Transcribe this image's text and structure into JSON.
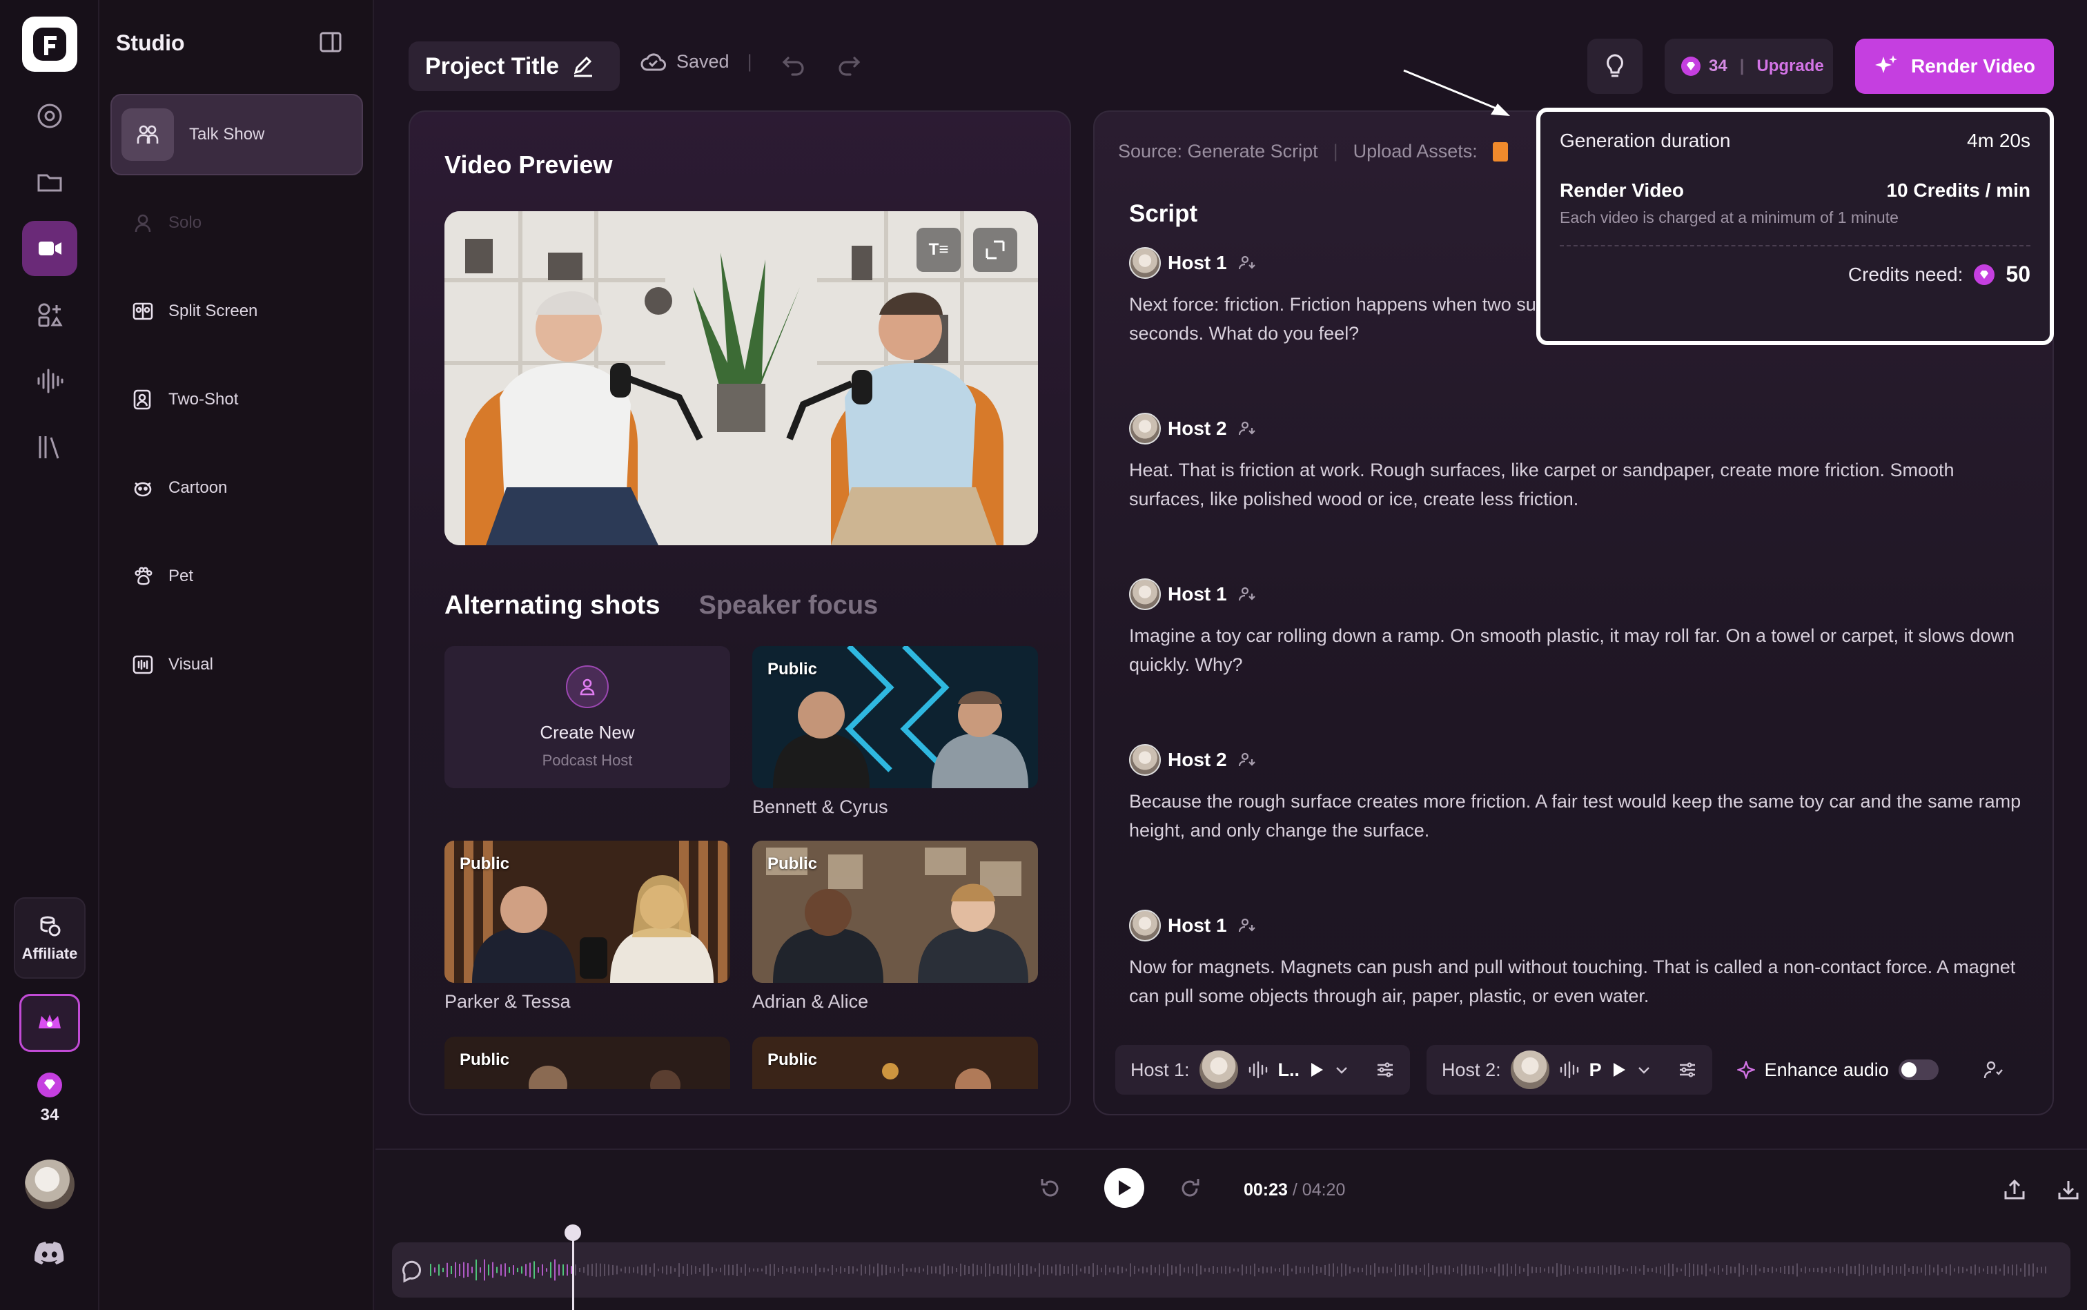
{
  "rail": {
    "affiliate_label": "Affiliate",
    "credits": "34"
  },
  "studio": {
    "title": "Studio",
    "items": [
      {
        "label": "Talk Show",
        "icon": "group-icon",
        "state": "active"
      },
      {
        "label": "Solo",
        "icon": "person-icon",
        "state": "disabled"
      },
      {
        "label": "Split Screen",
        "icon": "split-screen-icon",
        "state": "normal"
      },
      {
        "label": "Two-Shot",
        "icon": "two-shot-icon",
        "state": "normal"
      },
      {
        "label": "Cartoon",
        "icon": "cartoon-icon",
        "state": "normal"
      },
      {
        "label": "Pet",
        "icon": "paw-icon",
        "state": "normal"
      },
      {
        "label": "Visual",
        "icon": "visual-icon",
        "state": "normal"
      }
    ]
  },
  "topbar": {
    "project_title": "Project Title",
    "saved": "Saved",
    "credits": "34",
    "upgrade": "Upgrade",
    "render_button": "Render Video"
  },
  "preview": {
    "title": "Video Preview",
    "tabs": [
      "Alternating shots",
      "Speaker focus"
    ],
    "create_title": "Create New",
    "create_sub": "Podcast Host",
    "public_tag": "Public",
    "hosts": [
      "Bennett & Cyrus",
      "Parker & Tessa",
      "Adrian & Alice"
    ]
  },
  "script": {
    "source": "Source: Generate Script",
    "upload": "Upload Assets:",
    "title": "Script",
    "lines": [
      {
        "speaker": "Host 1",
        "text": "Next force: friction. Friction happens when two surfaces rub together. Rub your hands together for five seconds. What do you feel?"
      },
      {
        "speaker": "Host 2",
        "text": "Heat. That is friction at work. Rough surfaces, like carpet or sandpaper, create more friction. Smooth surfaces, like polished wood or ice, create less friction."
      },
      {
        "speaker": "Host 1",
        "text": "Imagine a toy car rolling down a ramp. On smooth plastic, it may roll far. On a towel or carpet, it slows down quickly. Why?"
      },
      {
        "speaker": "Host 2",
        "text": "Because the rough surface creates more friction. A fair test would keep the same toy car and the same ramp height, and only change the surface."
      },
      {
        "speaker": "Host 1",
        "text": "Now for magnets. Magnets can push and pull without touching. That is called a non-contact force. A magnet can pull some objects through air, paper, plastic, or even water."
      }
    ],
    "host1_label": "Host 1:",
    "host1_voice": "L..",
    "host2_label": "Host 2:",
    "host2_voice": "P",
    "enhance_audio": "Enhance audio"
  },
  "popup": {
    "duration_label": "Generation duration",
    "duration_value": "4m 20s",
    "render_label": "Render Video",
    "render_rate": "10 Credits / min",
    "min_note": "Each video is charged at a minimum of 1 minute",
    "need_label": "Credits need:",
    "need_value": "50"
  },
  "player": {
    "current": "00:23",
    "total": "/ 04:20",
    "progress": 0.088
  },
  "colors": {
    "accent": "#c53fe0",
    "background": "#1c1320"
  }
}
